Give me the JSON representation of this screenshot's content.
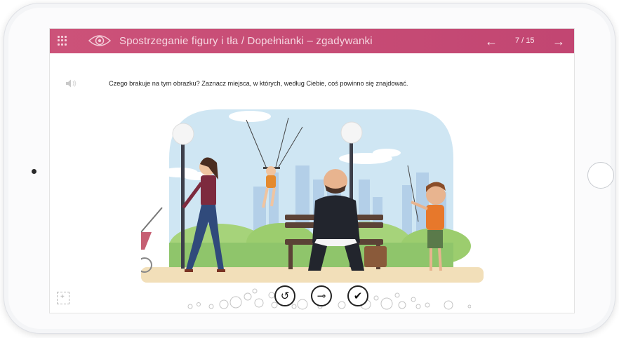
{
  "header": {
    "title": "Spostrzeganie figury i tła / Dopełnianki – zgadywanki",
    "counter": "7 / 15",
    "prev_arrow": "←",
    "next_arrow": "→"
  },
  "task": {
    "instruction": "Czego brakuje na tym obrazku? Zaznacz miejsca, w których, według Ciebie, coś powinno się znajdować."
  },
  "controls": {
    "reset_glyph": "↺",
    "key_glyph": "⊸",
    "check_glyph": "✔"
  },
  "colors": {
    "accent": "#c84a75",
    "sky": "#cfe6f2",
    "grass": "#8fc56b"
  },
  "icons": [
    "menu-grid-icon",
    "eye-icon",
    "speaker-icon",
    "frame-icon"
  ]
}
